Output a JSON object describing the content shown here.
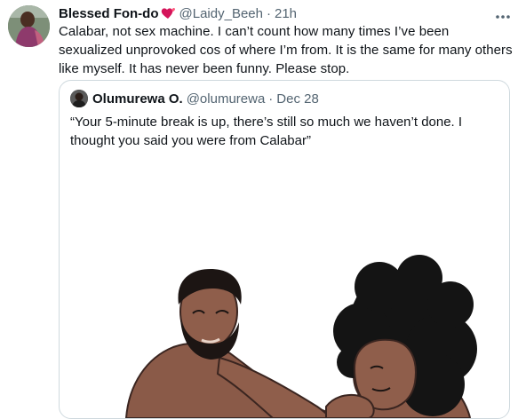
{
  "tweet": {
    "author_name": "Blessed Fon-do",
    "author_handle": "@Laidy_Beeh",
    "separator": "·",
    "time": "21h",
    "text": "Calabar, not sex machine. I can’t count how many times I’ve been sexualized unprovoked cos of where I’m from. It is the same for many others like myself. It has never been funny. Please stop."
  },
  "quote": {
    "author_name": "Olumurewa O.",
    "author_handle": "@olumurewa",
    "separator": "·",
    "date": "Dec 28",
    "text": "“Your 5-minute break is up, there’s still so much we haven’t done. I thought you said you were from Calabar”"
  },
  "icons": {
    "name_emoji": "heart-emoji-icon",
    "more": "more-options-icon"
  },
  "colors": {
    "text": "#0f1419",
    "secondary": "#536471",
    "border": "#cfd9de"
  }
}
